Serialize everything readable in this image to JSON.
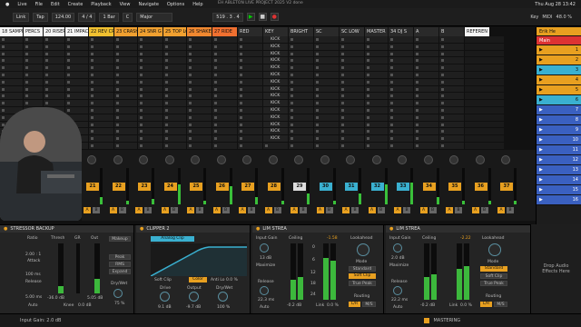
{
  "menubar": {
    "items": [
      "Live",
      "File",
      "Edit",
      "Create",
      "Playback",
      "View",
      "Navigate",
      "Options",
      "Help"
    ],
    "clock": "Thu Aug 28 13:42"
  },
  "transport": {
    "link": "Link",
    "tap": "Tap",
    "tempo": "124.00",
    "signature": "4 / 4",
    "quantize": "1 Bar",
    "key": "C",
    "scale": "Major",
    "position": "519 . 3 . 4",
    "project_title": "EH ABLETON LIVE PROJECT 2025 V2 done",
    "key_label": "Key",
    "midi_label": "MIDI",
    "cpu": "48.0 %"
  },
  "tracks": [
    {
      "name": "18 SAMPL",
      "color": "#f5f5f5"
    },
    {
      "name": "PERCS",
      "color": "#f5f5f5"
    },
    {
      "name": "20 RISERS",
      "color": "#f5f5f5"
    },
    {
      "name": "21 IMPAC",
      "color": "#f5f5f5"
    },
    {
      "name": "22 REV CR",
      "color": "#f0c030"
    },
    {
      "name": "23 CRASH",
      "color": "#f0a030"
    },
    {
      "name": "24 SNR G",
      "color": "#f0a030"
    },
    {
      "name": "25 TOP LO",
      "color": "#f0a030"
    },
    {
      "name": "26 SHAKE",
      "color": "#f08830"
    },
    {
      "name": "27 RIDE",
      "color": "#f07030"
    },
    {
      "name": "RED",
      "color": "#2a2a2a"
    },
    {
      "name": "KEY",
      "color": "#2a2a2a"
    },
    {
      "name": "BRIGHT",
      "color": "#2a2a2a"
    },
    {
      "name": "SC",
      "color": "#2a2a2a"
    },
    {
      "name": "SC LOW",
      "color": "#2a2a2a"
    },
    {
      "name": "MASTER",
      "color": "#2a2a2a"
    },
    {
      "name": "34 DJ S",
      "color": "#2a2a2a"
    },
    {
      "name": "A",
      "color": "#2a2a2a"
    },
    {
      "name": "B",
      "color": "#2a2a2a"
    },
    {
      "name": "REFEREN",
      "color": "#f5f5f5"
    }
  ],
  "kick_label": "KICK",
  "kick_count": 15,
  "master_panel": {
    "title": "Main",
    "scenes": [
      "1",
      "2",
      "3",
      "4",
      "5",
      "6",
      "7",
      "8",
      "9",
      "10",
      "11",
      "12",
      "13",
      "14",
      "15",
      "16"
    ],
    "reference": "Erik He"
  },
  "mixer_strips": [
    {
      "num": "21",
      "color": "orange"
    },
    {
      "num": "22",
      "color": "orange"
    },
    {
      "num": "23",
      "color": "orange"
    },
    {
      "num": "24",
      "color": "orange"
    },
    {
      "num": "25",
      "color": "orange"
    },
    {
      "num": "26",
      "color": "orange"
    },
    {
      "num": "27",
      "color": "orange"
    },
    {
      "num": "28",
      "color": "orange"
    },
    {
      "num": "29",
      "color": "gray"
    },
    {
      "num": "30",
      "color": "blue"
    },
    {
      "num": "31",
      "color": "blue"
    },
    {
      "num": "32",
      "color": "blue"
    },
    {
      "num": "33",
      "color": "blue"
    },
    {
      "num": "34",
      "color": "orange"
    },
    {
      "num": "35",
      "color": "orange"
    },
    {
      "num": "36",
      "color": "orange"
    },
    {
      "num": "37",
      "color": "orange"
    }
  ],
  "meter_levels": [
    0.2,
    0.1,
    0.15,
    0.55,
    0.1,
    0.5,
    0.2,
    0.1,
    0.3,
    0.1,
    0.3,
    0.55,
    0.6,
    0.2,
    0.1,
    0.1,
    0.1
  ],
  "devices": {
    "compressor": {
      "title": "STRESSOR BACKUP",
      "ratio_label": "Ratio",
      "ratio": "2.00 : 1",
      "thresh_label": "Thresh",
      "gr_label": "GR",
      "out_label": "Out",
      "attack_label": "Attack",
      "attack": "100 ms",
      "release_label": "Release",
      "release": "5.00 ms",
      "thresh_value": "-36.0 dB",
      "out_value": "5.05 dB",
      "knee_label": "Knee",
      "knee": "0.0 dB",
      "makeup": "Makeup",
      "peak": "Peak",
      "rms": "RMS",
      "expand": "Expand",
      "drywet_label": "Dry/Wet",
      "drywet": "75 %",
      "auto_label": "Auto"
    },
    "clipper": {
      "title": "CLIPPER 2",
      "mode": "Analog Clip",
      "soft_clip": "Soft Clip",
      "color_label": "Color",
      "anti_lo": "Anti Lo 0.0 %",
      "drive_label": "Drive",
      "drive": "9.1 dB",
      "output_label": "Output",
      "output": "-9.7 dB",
      "drywet_label": "Dry/Wet",
      "drywet": "100 %"
    },
    "limiter1": {
      "title": "LIM STREA",
      "input_gain_label": "Input Gain",
      "input_gain": "13 dB",
      "maximize": "Maximize",
      "ceiling_label": "Ceiling",
      "ceiling": "-0.2 dB",
      "meter_value": "-1.58",
      "release_label": "Release",
      "release": "22.3 ms",
      "auto_label": "Auto",
      "link_label": "Link",
      "link": "0.0 %",
      "lookahead_label": "Lookahead",
      "mode_label": "Mode",
      "mode": "Standard",
      "soft_clip": "Soft Clip",
      "true_peak": "True Peak",
      "routing_label": "Routing",
      "lr": "L/R",
      "ms": "M/S",
      "scale": [
        "0",
        "6",
        "12",
        "18",
        "24"
      ]
    },
    "limiter2": {
      "title": "LIM STREA",
      "input_gain_label": "Input Gain",
      "input_gain": "2.0 dB",
      "maximize": "Maximize",
      "ceiling_label": "Ceiling",
      "ceiling": "-0.2 dB",
      "meter_value": "-2.22",
      "release_label": "Release",
      "release": "22.2 ms",
      "auto_label": "Auto",
      "link_label": "Link",
      "link": "0.0 %",
      "lookahead_label": "Lookahead",
      "mode_label": "Mode",
      "mode": "Standard",
      "soft_clip": "Soft Clip",
      "true_peak": "True Peak",
      "routing_label": "Routing",
      "lr": "L/R",
      "ms": "M/S"
    },
    "drop_zone": "Drop Audio Effects Here"
  },
  "status": {
    "input_gain": "Input Gain: 2.0 dB",
    "track": "MASTERING"
  }
}
